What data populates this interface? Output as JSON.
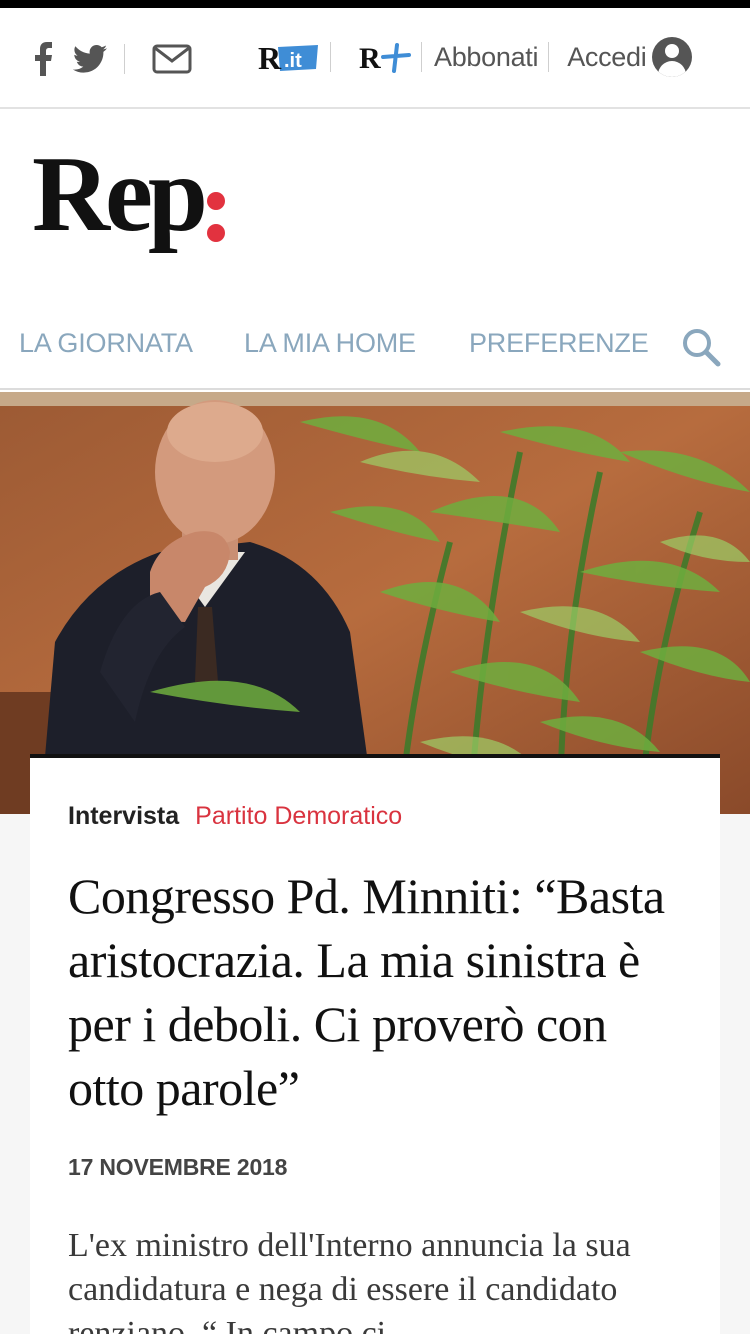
{
  "header": {
    "abbonati_label": "Abbonati",
    "accedi_label": "Accedi",
    "r_it_label": "R.it",
    "r_plus_label": "R+"
  },
  "logo": {
    "text": "Rep",
    "accent_color": "#e2323f"
  },
  "nav": {
    "items": [
      {
        "label": "LA GIORNATA"
      },
      {
        "label": "LA MIA HOME"
      },
      {
        "label": "PREFERENZE"
      }
    ],
    "search_icon": "search-icon",
    "color": "#8aa7bd"
  },
  "article": {
    "kicker_type": "Intervista",
    "kicker_section": "Partito Demoratico",
    "headline": "Congresso Pd. Minniti: “Basta aristocrazia. La mia sinistra è per i deboli. Ci proverò con otto parole”",
    "date": "17 NOVEMBRE 2018",
    "summary": "L'ex ministro dell'Interno annuncia la sua candidatura e nega di essere il candidato renziano. “ In campo ci"
  },
  "icons": [
    "facebook-icon",
    "twitter-icon",
    "mail-icon",
    "user-avatar-icon",
    "search-icon"
  ]
}
